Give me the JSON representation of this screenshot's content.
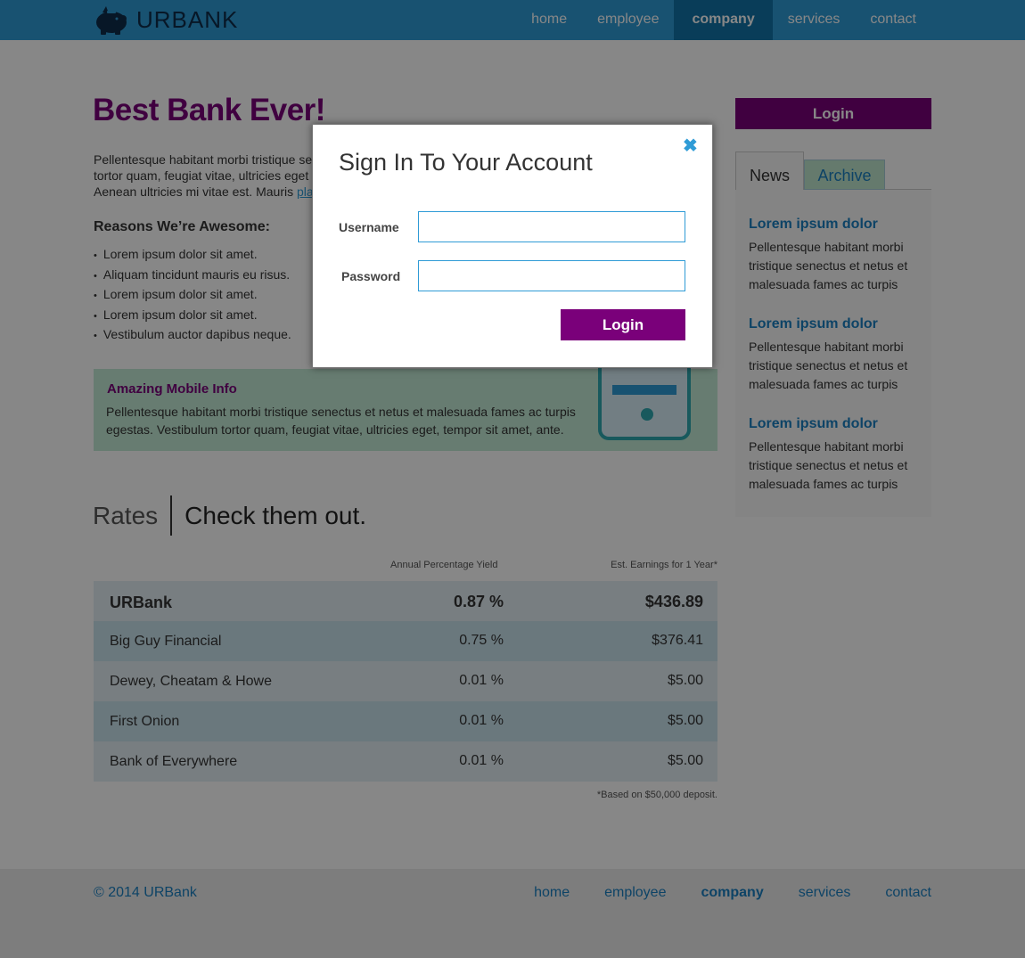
{
  "brand": {
    "name": "URBANK"
  },
  "nav": [
    "home",
    "employee",
    "company",
    "services",
    "contact"
  ],
  "nav_active": "company",
  "hero": {
    "title": "Best Bank Ever!",
    "intro_lines": [
      "Pellentesque habitant morbi tristique se",
      "tortor quam, feugiat vitae, ultricies eget",
      "Aenean ultricies mi vitae est. Mauris "
    ],
    "intro_link": "pla"
  },
  "reasons": {
    "title": "Reasons We’re Awesome:",
    "items": [
      "Lorem ipsum dolor sit amet.",
      "Aliquam tincidunt mauris eu risus.",
      "Lorem ipsum dolor sit amet.",
      "Lorem ipsum dolor sit amet.",
      "Vestibulum auctor dapibus neque."
    ]
  },
  "mobile": {
    "title": "Amazing Mobile Info",
    "text": "Pellentesque habitant morbi tristique senectus et netus et malesuada fames ac turpis egestas. Vestibulum tortor quam, feugiat vitae, ultricies eget, tempor sit amet, ante."
  },
  "rates": {
    "heading": "Rates",
    "subheading": "Check them out.",
    "col_apy": "Annual Percentage Yield",
    "col_earn": "Est. Earnings for 1 Year*",
    "rows": [
      {
        "name": "URBank",
        "apy": "0.87 %",
        "earn": "$436.89"
      },
      {
        "name": "Big Guy Financial",
        "apy": "0.75 %",
        "earn": "$376.41"
      },
      {
        "name": "Dewey, Cheatam & Howe",
        "apy": "0.01 %",
        "earn": "$5.00"
      },
      {
        "name": "First Onion",
        "apy": "0.01 %",
        "earn": "$5.00"
      },
      {
        "name": "Bank of Everywhere",
        "apy": "0.01 %",
        "earn": "$5.00"
      }
    ],
    "footnote": "*Based on $50,000 deposit."
  },
  "sidebar": {
    "login_label": "Login",
    "tabs": [
      "News",
      "Archive"
    ],
    "news": [
      {
        "title": "Lorem ipsum dolor",
        "body": "Pellentesque habitant morbi tristique senectus et netus et malesuada fames ac turpis"
      },
      {
        "title": "Lorem ipsum dolor",
        "body": "Pellentesque habitant morbi tristique senectus et netus et malesuada fames ac turpis"
      },
      {
        "title": "Lorem ipsum dolor",
        "body": "Pellentesque habitant morbi tristique senectus et netus et malesuada fames ac turpis"
      }
    ]
  },
  "footer": {
    "copyright": "© 2014 URBank",
    "nav": [
      "home",
      "employee",
      "company",
      "services",
      "contact"
    ]
  },
  "modal": {
    "title": "Sign In To Your Account",
    "username_label": "Username",
    "username_value": "",
    "password_label": "Password",
    "password_value": "",
    "login_label": "Login",
    "close_icon": "close-icon"
  },
  "colors": {
    "primary_blue": "#2f9bd6",
    "accent_purple": "#7a007a",
    "mint": "#c2ead5"
  }
}
